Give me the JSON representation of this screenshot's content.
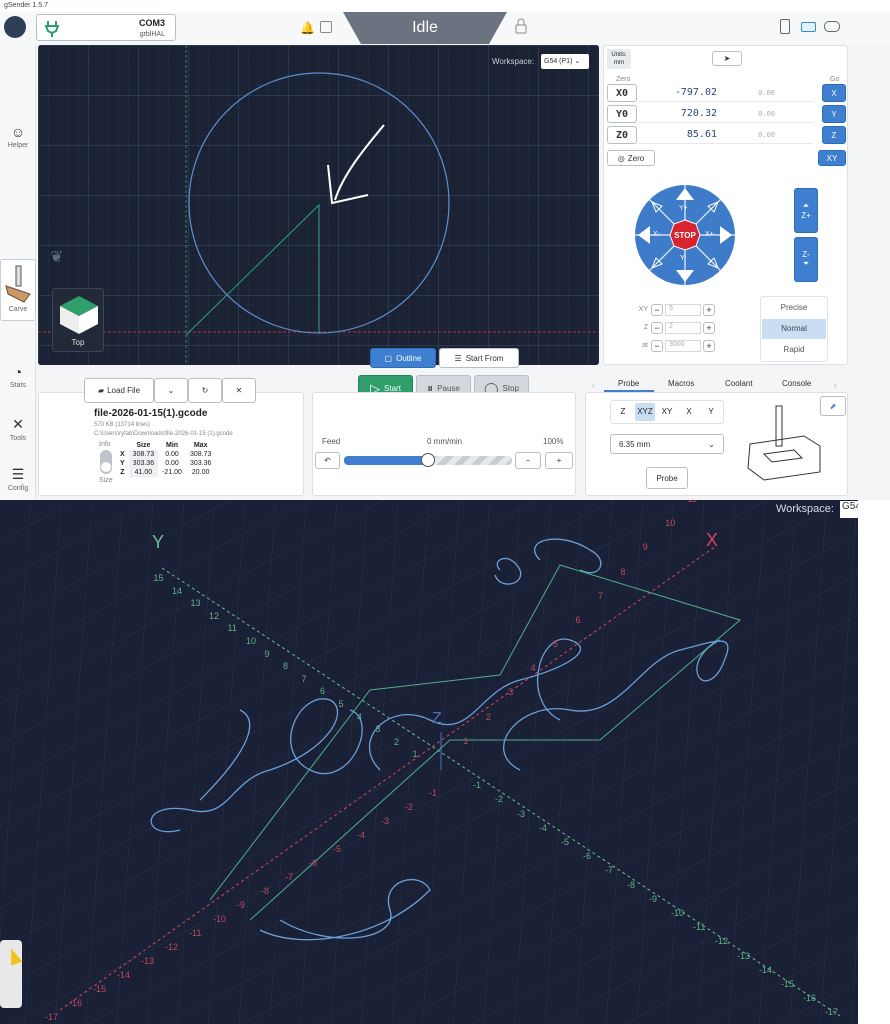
{
  "window": {
    "title": "gSender 1.5.7"
  },
  "topbar": {
    "port": "COM3",
    "firmware": "grblHAL",
    "state": "Idle"
  },
  "sidebar": {
    "items": [
      {
        "label": "Helper",
        "icon": "helper-icon"
      },
      {
        "label": "Carve",
        "icon": "carve-icon"
      },
      {
        "label": "Stats",
        "icon": "stats-icon"
      },
      {
        "label": "Tools",
        "icon": "tools-icon"
      },
      {
        "label": "Config",
        "icon": "config-icon"
      }
    ]
  },
  "visualizer": {
    "workspace_label": "Workspace:",
    "workspace_value": "G54 (P1)",
    "view_label": "Top",
    "outline_label": "Outline",
    "start_from_label": "Start From"
  },
  "dro": {
    "units_label": "Units:",
    "units_value": "mm",
    "zero_header": "Zero",
    "go_header": "Go",
    "axes": [
      {
        "name": "X0",
        "value": "-797.02",
        "mpos": "0.00",
        "go": "X"
      },
      {
        "name": "Y0",
        "value": "720.32",
        "mpos": "0.00",
        "go": "Y"
      },
      {
        "name": "Z0",
        "value": "85.61",
        "mpos": "0.00",
        "go": "Z"
      }
    ],
    "zero_all_label": "Zero",
    "go_xy_label": "XY"
  },
  "jog": {
    "y_plus": "Y+",
    "y_minus": "Y-",
    "x_minus": "X-",
    "x_plus": "X+",
    "stop": "STOP",
    "z_plus": "Z+",
    "z_minus": "Z-",
    "xy_label": "XY",
    "z_label": "Z",
    "at_label": "at",
    "xy_value": "5",
    "z_value": "2",
    "at_value": "3000",
    "speeds": [
      "Precise",
      "Normal",
      "Rapid"
    ],
    "active_speed": "Normal"
  },
  "job": {
    "start_label": "Start",
    "pause_label": "Pause",
    "stop_label": "Stop",
    "load_file_label": "Load File",
    "filename": "file-2026-01-15(1).gcode",
    "fileinfo": "570 KB (13714 lines)",
    "filepath": "C:\\Users\\ryfab\\Downloads\\file-2026-01-15 (1).gcode",
    "info_label": "Info",
    "size_label": "Size",
    "size_table": {
      "headers": [
        "",
        "Size",
        "Min",
        "Max"
      ],
      "rows": [
        [
          "X",
          "308.73",
          "0.00",
          "308.73"
        ],
        [
          "Y",
          "303.36",
          "0.00",
          "303.36"
        ],
        [
          "Z",
          "41.00",
          "-21.00",
          "20.00"
        ]
      ]
    }
  },
  "feed": {
    "label": "Feed",
    "rate": "0 mm/min",
    "percent": "100%",
    "override_fraction": 0.5
  },
  "tools": {
    "tabs": [
      "Probe",
      "Macros",
      "Coolant",
      "Console"
    ],
    "active_tab": "Probe",
    "axis_options": [
      "Z",
      "XYZ",
      "XY",
      "X",
      "Y"
    ],
    "active_axis": "XYZ",
    "diameter": "6.35 mm",
    "probe_button": "Probe"
  },
  "view3d": {
    "workspace_label": "Workspace:",
    "workspace_value": "G54",
    "x_label": "X",
    "y_label": "Y",
    "z_label": "Z",
    "x_ticks_pos": [
      "1",
      "2",
      "3",
      "4",
      "5",
      "6",
      "7",
      "8",
      "9",
      "10",
      "11",
      "12",
      "13",
      "14"
    ],
    "x_ticks_neg": [
      "-1",
      "-2",
      "-3",
      "-4",
      "-5",
      "-6",
      "-7",
      "-8",
      "-9",
      "-10",
      "-11",
      "-12",
      "-13",
      "-14",
      "-15",
      "-16",
      "-17"
    ],
    "y_ticks_pos": [
      "1",
      "2",
      "3",
      "4",
      "5",
      "6",
      "7",
      "8",
      "9",
      "10",
      "11",
      "12",
      "13",
      "14",
      "15"
    ],
    "y_ticks_neg": [
      "-1",
      "-2",
      "-3",
      "-4",
      "-5",
      "-6",
      "-7",
      "-8",
      "-9",
      "-10",
      "-11",
      "-12",
      "-13",
      "-14",
      "-15",
      "-16",
      "-17"
    ]
  },
  "colors": {
    "accent": "#3f7fcf",
    "stop": "#d9232e",
    "start": "#2f9e6a",
    "viz_bg": "#1b2233",
    "toolpath": "#6a9fd9"
  }
}
